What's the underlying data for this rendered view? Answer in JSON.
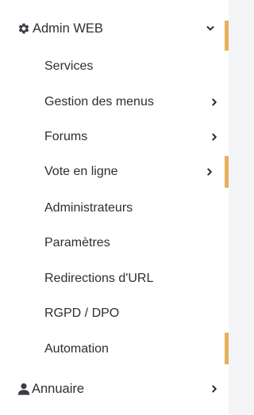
{
  "menu": {
    "admin": {
      "label": "Admin WEB",
      "icon": "gear-icon",
      "expanded": true
    },
    "items": [
      {
        "label": "Services",
        "has_submenu": false
      },
      {
        "label": "Gestion des menus",
        "has_submenu": true
      },
      {
        "label": "Forums",
        "has_submenu": true
      },
      {
        "label": "Vote en ligne",
        "has_submenu": true
      },
      {
        "label": "Administrateurs",
        "has_submenu": false
      },
      {
        "label": "Paramètres",
        "has_submenu": false
      },
      {
        "label": "Redirections d'URL",
        "has_submenu": false
      },
      {
        "label": "RGPD / DPO",
        "has_submenu": false
      },
      {
        "label": "Automation",
        "has_submenu": false
      }
    ],
    "annuaire": {
      "label": "Annuaire",
      "icon": "user-icon",
      "expanded": false
    }
  },
  "colors": {
    "accent": "#e7b15c",
    "text": "#2b2f36",
    "background": "#ffffff"
  }
}
